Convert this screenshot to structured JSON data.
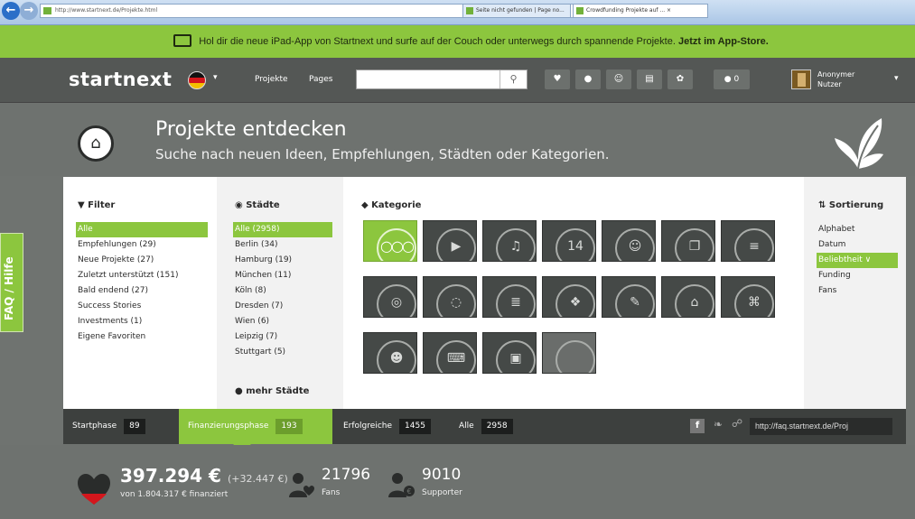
{
  "browser": {
    "url": "http://www.startnext.de/Projekte.html",
    "url_host": "startnext.de",
    "address_tools": "⌕ ▾ ≡ ↻ ×",
    "tabs": [
      {
        "label": "Seite nicht gefunden | Page no..."
      },
      {
        "label": "Crowdfunding Projekte auf ... ×"
      }
    ]
  },
  "banner": {
    "text": "Hol dir die neue iPad-App von Startnext und surfe auf der Couch oder unterwegs durch spannende Projekte.",
    "link": "Jetzt im App-Store."
  },
  "header": {
    "logo": "startnext",
    "nav": {
      "projekte": "Projekte",
      "pages": "Pages"
    },
    "search_placeholder": "",
    "message_count": "0",
    "user_line1": "Anonymer",
    "user_line2": "Nutzer"
  },
  "hero": {
    "title": "Projekte entdecken",
    "subtitle": "Suche nach neuen Ideen, Empfehlungen, Städten oder Kategorien."
  },
  "faq": {
    "label": "FAQ / Hilfe"
  },
  "filter": {
    "heading": "▼ Filter",
    "items": [
      {
        "label": "Alle"
      },
      {
        "label": "Empfehlungen (29)"
      },
      {
        "label": "Neue Projekte (27)"
      },
      {
        "label": "Zuletzt unterstützt (151)"
      },
      {
        "label": "Bald endend (27)"
      },
      {
        "label": "Success Stories"
      },
      {
        "label": "Investments (1)"
      },
      {
        "label": "Eigene Favoriten"
      }
    ]
  },
  "staedte": {
    "heading": "◉ Städte",
    "items": [
      {
        "label": "Alle (2958)"
      },
      {
        "label": "Berlin (34)"
      },
      {
        "label": "Hamburg (19)"
      },
      {
        "label": "München (11)"
      },
      {
        "label": "Köln (8)"
      },
      {
        "label": "Dresden (7)"
      },
      {
        "label": "Wien (6)"
      },
      {
        "label": "Leipzig (7)"
      },
      {
        "label": "Stuttgart (5)"
      }
    ],
    "mehr": "● mehr Städte"
  },
  "kategorie": {
    "heading": "◆ Kategorie",
    "tiles": [
      {
        "icon": "grid-icon",
        "glyph": "○○○"
      },
      {
        "icon": "film-icon",
        "glyph": "▶"
      },
      {
        "icon": "music-icon",
        "glyph": "♫"
      },
      {
        "icon": "calendar-icon",
        "glyph": "14"
      },
      {
        "icon": "mask-icon",
        "glyph": "☺"
      },
      {
        "icon": "book-icon",
        "glyph": "❐"
      },
      {
        "icon": "piano-icon",
        "glyph": "≡"
      },
      {
        "icon": "camera-icon",
        "glyph": "◎"
      },
      {
        "icon": "lightbulb-icon",
        "glyph": "◌"
      },
      {
        "icon": "newspaper-icon",
        "glyph": "≣"
      },
      {
        "icon": "puzzle-icon",
        "glyph": "❖"
      },
      {
        "icon": "pencil-icon",
        "glyph": "✎"
      },
      {
        "icon": "hat-icon",
        "glyph": "⌂"
      },
      {
        "icon": "gamepad-icon",
        "glyph": "⌘"
      },
      {
        "icon": "people-icon",
        "glyph": "☻"
      },
      {
        "icon": "keyboard-icon",
        "glyph": "⌨"
      },
      {
        "icon": "phone-icon",
        "glyph": "▣"
      },
      {
        "icon": "blank-icon",
        "glyph": ""
      }
    ]
  },
  "sortierung": {
    "heading": "⇅ Sortierung",
    "items": [
      {
        "label": "Alphabet"
      },
      {
        "label": "Datum"
      },
      {
        "label": "Beliebtheit ∨"
      },
      {
        "label": "Funding"
      },
      {
        "label": "Fans"
      }
    ]
  },
  "phases": [
    {
      "label": "Startphase",
      "count": "89"
    },
    {
      "label": "Finanzierungsphase",
      "count": "193"
    },
    {
      "label": "Erfolgreiche",
      "count": "1455"
    },
    {
      "label": "Alle",
      "count": "2958"
    }
  ],
  "share": {
    "facebook": "f",
    "twitter": "❧",
    "link": "☍",
    "url": "http://faq.startnext.de/Proj"
  },
  "stats": {
    "amount": "397.294 €",
    "amount_delta": "(+32.447 €)",
    "amount_sub": "von 1.804.317 € finanziert",
    "fans_num": "21796",
    "fans_label": "Fans",
    "supporter_num": "9010",
    "supporter_label": "Supporter"
  },
  "colors": {
    "brand_green": "#8cc63e",
    "header_bg": "#545755",
    "panel_bg": "#ffffff"
  }
}
